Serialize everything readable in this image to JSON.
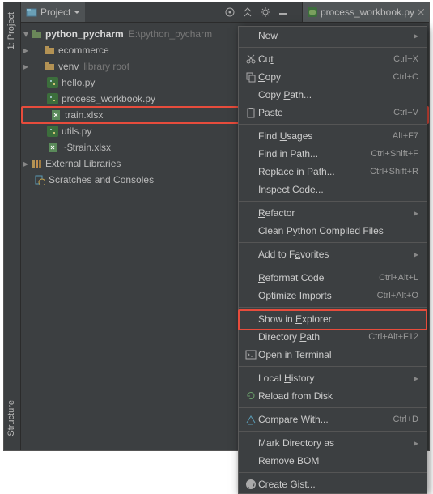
{
  "toolbar": {
    "project_label": "Project",
    "tab": "process_workbook.py"
  },
  "vbars": {
    "project": "1: Project",
    "structure": "Structure"
  },
  "tree": {
    "root": {
      "name": "python_pycharm",
      "path": "E:\\python_pycharm"
    },
    "items": [
      {
        "icon": "folder",
        "label": "ecommerce"
      },
      {
        "icon": "folder",
        "label": "venv",
        "suffix": "library root"
      },
      {
        "icon": "py",
        "label": "hello.py"
      },
      {
        "icon": "py",
        "label": "process_workbook.py"
      },
      {
        "icon": "xls",
        "label": "train.xlsx",
        "hl": true
      },
      {
        "icon": "py",
        "label": "utils.py"
      },
      {
        "icon": "xls",
        "label": "~$train.xlsx"
      }
    ],
    "ext": "External Libraries",
    "scratch": "Scratches and Consoles"
  },
  "menu": [
    {
      "t": "New",
      "sub": true
    },
    {
      "sep": true
    },
    {
      "t": "Cut",
      "sc": "Ctrl+X",
      "icon": "cut",
      "u": 2
    },
    {
      "t": "Copy",
      "sc": "Ctrl+C",
      "icon": "copy",
      "u": 0
    },
    {
      "t": "Copy Path...",
      "u": 5
    },
    {
      "t": "Paste",
      "sc": "Ctrl+V",
      "icon": "paste",
      "u": 0
    },
    {
      "sep": true
    },
    {
      "t": "Find Usages",
      "sc": "Alt+F7",
      "u": 5
    },
    {
      "t": "Find in Path...",
      "sc": "Ctrl+Shift+F"
    },
    {
      "t": "Replace in Path...",
      "sc": "Ctrl+Shift+R"
    },
    {
      "t": "Inspect Code..."
    },
    {
      "sep": true
    },
    {
      "t": "Refactor",
      "sub": true,
      "u": 0
    },
    {
      "t": "Clean Python Compiled Files"
    },
    {
      "sep": true
    },
    {
      "t": "Add to Favorites",
      "sub": true,
      "u": 8
    },
    {
      "sep": true
    },
    {
      "t": "Reformat Code",
      "sc": "Ctrl+Alt+L",
      "u": 0
    },
    {
      "t": "Optimize Imports",
      "sc": "Ctrl+Alt+O",
      "u": 8
    },
    {
      "sep": true
    },
    {
      "t": "Show in Explorer",
      "hl": true,
      "u": 8
    },
    {
      "t": "Directory Path",
      "sc": "Ctrl+Alt+F12",
      "u": 10
    },
    {
      "t": "Open in Terminal",
      "icon": "term"
    },
    {
      "sep": true
    },
    {
      "t": "Local History",
      "sub": true,
      "u": 6
    },
    {
      "t": "Reload from Disk",
      "icon": "reload"
    },
    {
      "sep": true
    },
    {
      "t": "Compare With...",
      "sc": "Ctrl+D",
      "icon": "compare"
    },
    {
      "sep": true
    },
    {
      "t": "Mark Directory as",
      "sub": true
    },
    {
      "t": "Remove BOM"
    },
    {
      "sep": true
    },
    {
      "t": "Create Gist...",
      "icon": "gh"
    }
  ]
}
